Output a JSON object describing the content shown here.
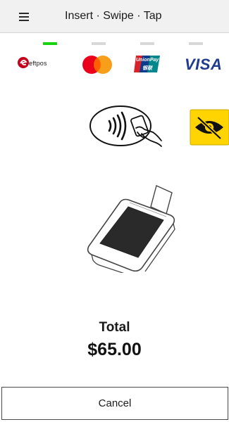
{
  "header": {
    "title": "Insert · Swipe · Tap",
    "menu_icon": "hamburger-menu-icon"
  },
  "indicators": [
    {
      "scheme": "eftpos",
      "active": true
    },
    {
      "scheme": "mastercard",
      "active": false
    },
    {
      "scheme": "unionpay",
      "active": false
    },
    {
      "scheme": "visa",
      "active": false
    }
  ],
  "logos": {
    "eftpos_text": "eftpos",
    "unionpay_line1": "UnionPay",
    "unionpay_line2": "银联",
    "visa_text": "VISA"
  },
  "colors": {
    "active_indicator": "#19d40c",
    "inactive_indicator": "#d8d8d8",
    "eftpos_red": "#c4001a",
    "mastercard_red": "#eb001b",
    "mastercard_orange": "#f79e1b",
    "visa_blue": "#1f3a8f",
    "accessibility_yellow": "#ffd400"
  },
  "icons": {
    "contactless": "contactless-tap-icon",
    "accessibility": "eye-slash-accessibility-icon",
    "terminal": "payment-terminal-icon"
  },
  "payment": {
    "total_label": "Total",
    "total_amount": "$65.00"
  },
  "actions": {
    "cancel_label": "Cancel"
  }
}
